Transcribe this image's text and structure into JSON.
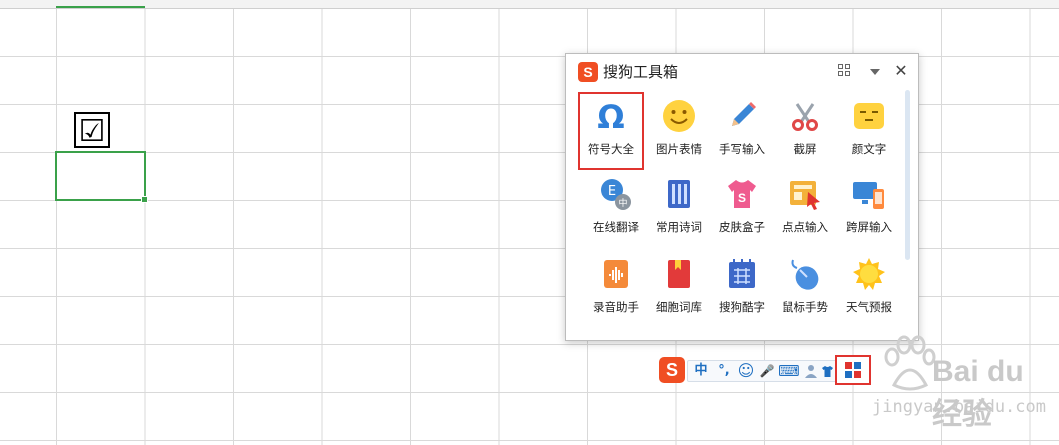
{
  "toolbox": {
    "logo": "S",
    "title": "搜狗工具箱",
    "close_glyph": "✕",
    "tiles": [
      {
        "label": "符号大全"
      },
      {
        "label": "图片表情"
      },
      {
        "label": "手写输入"
      },
      {
        "label": "截屏"
      },
      {
        "label": "颜文字"
      },
      {
        "label": "在线翻译"
      },
      {
        "label": "常用诗词"
      },
      {
        "label": "皮肤盒子"
      },
      {
        "label": "点点输入"
      },
      {
        "label": "跨屏输入"
      },
      {
        "label": "录音助手"
      },
      {
        "label": "细胞词库"
      },
      {
        "label": "搜狗酷字"
      },
      {
        "label": "鼠标手势"
      },
      {
        "label": "天气预报"
      }
    ]
  },
  "sheet": {
    "checkbox_char": "☑"
  },
  "ime": {
    "logo": "S",
    "mode": "中",
    "punct": "°,",
    "emoji": "☺",
    "mic": "🎤",
    "keyboard": "⌨"
  },
  "watermark": {
    "text": "Bai du 经验",
    "url": "jingyan.baidu.com"
  },
  "colors": {
    "accent_green": "#3aa14a",
    "highlight_red": "#e0342f",
    "sogou_orange": "#f04e23"
  }
}
